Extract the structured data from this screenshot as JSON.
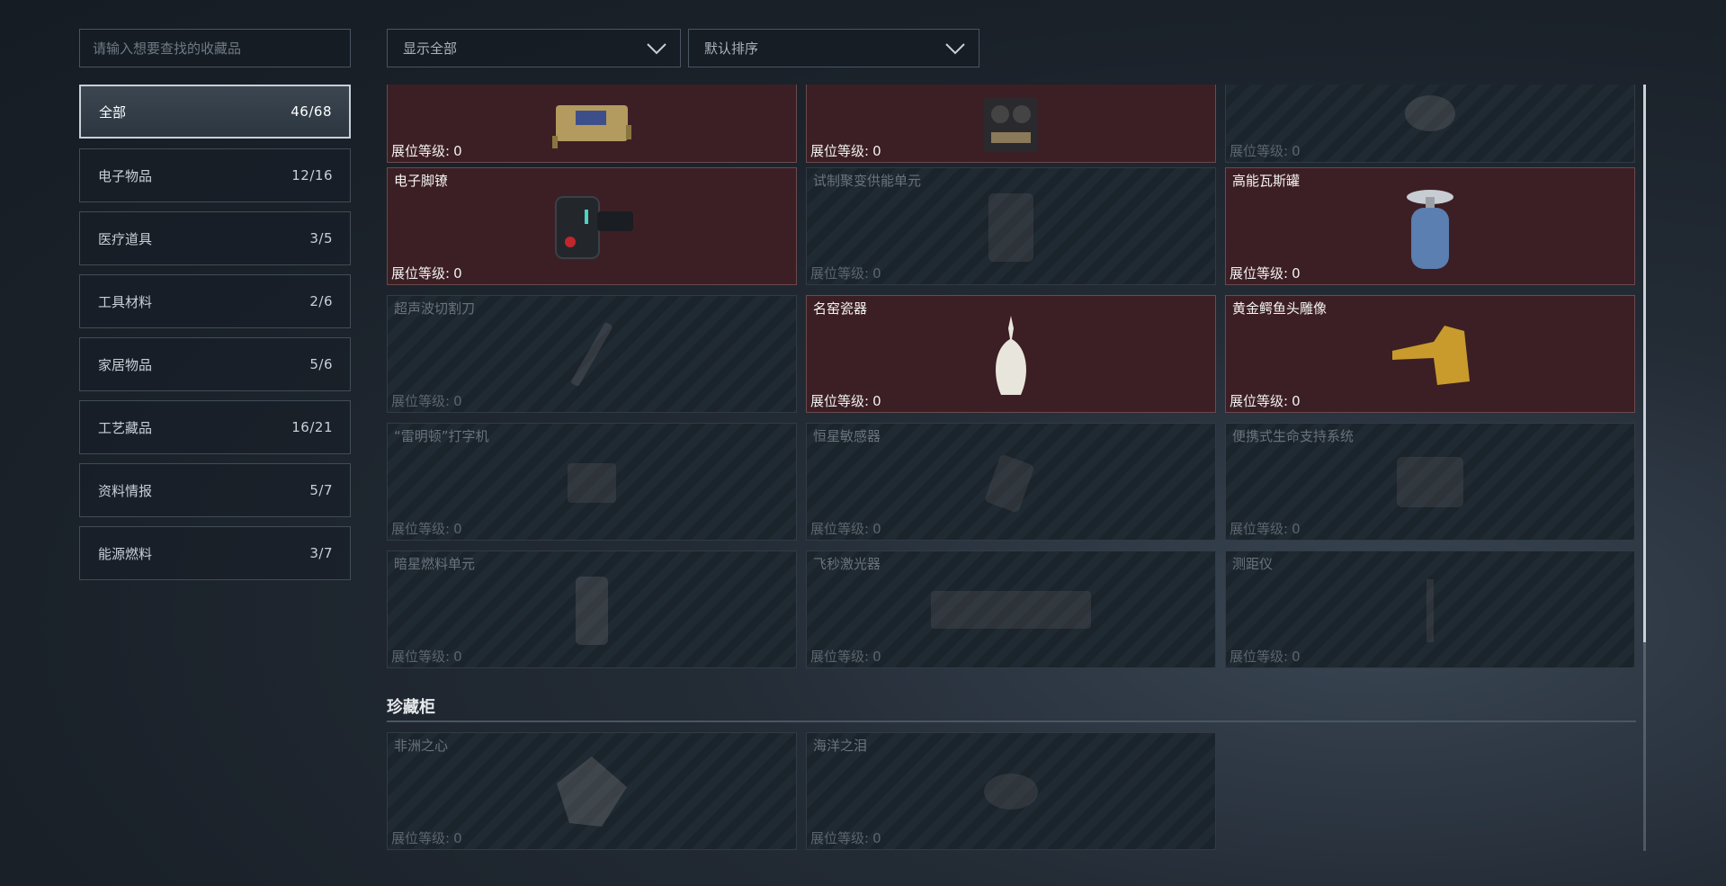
{
  "search": {
    "placeholder": "请输入想要查找的收藏品"
  },
  "filters": {
    "display": "显示全部",
    "sort": "默认排序"
  },
  "sidebar": {
    "items": [
      {
        "label": "全部",
        "count": "46/68"
      },
      {
        "label": "电子物品",
        "count": "12/16"
      },
      {
        "label": "医疗道具",
        "count": "3/5"
      },
      {
        "label": "工具材料",
        "count": "2/6"
      },
      {
        "label": "家居物品",
        "count": "5/6"
      },
      {
        "label": "工艺藏品",
        "count": "16/21"
      },
      {
        "label": "资料情报",
        "count": "5/7"
      },
      {
        "label": "能源燃料",
        "count": "3/7"
      }
    ]
  },
  "level_label": "展位等级:",
  "grid": {
    "items": [
      {
        "name": "",
        "level": "0",
        "owned": true,
        "icon": "router-device-icon"
      },
      {
        "name": "",
        "level": "0",
        "owned": true,
        "icon": "tape-recorder-icon"
      },
      {
        "name": "",
        "level": "0",
        "owned": false,
        "icon": "artifact-icon"
      },
      {
        "name": "电子脚镣",
        "level": "0",
        "owned": true,
        "icon": "ankle-monitor-icon"
      },
      {
        "name": "试制聚变供能单元",
        "level": "0",
        "owned": false,
        "icon": "fusion-unit-icon"
      },
      {
        "name": "高能瓦斯罐",
        "level": "0",
        "owned": true,
        "icon": "gas-canister-icon"
      },
      {
        "name": "超声波切割刀",
        "level": "0",
        "owned": false,
        "icon": "cutter-icon"
      },
      {
        "name": "名窑瓷器",
        "level": "0",
        "owned": true,
        "icon": "porcelain-vase-icon"
      },
      {
        "name": "黄金鳄鱼头雕像",
        "level": "0",
        "owned": true,
        "icon": "gold-crocodile-icon"
      },
      {
        "name": "“雷明顿”打字机",
        "level": "0",
        "owned": false,
        "icon": "typewriter-icon"
      },
      {
        "name": "恒星敏感器",
        "level": "0",
        "owned": false,
        "icon": "star-sensor-icon"
      },
      {
        "name": "便携式生命支持系统",
        "level": "0",
        "owned": false,
        "icon": "life-support-icon"
      },
      {
        "name": "暗星燃料单元",
        "level": "0",
        "owned": false,
        "icon": "fuel-cell-icon"
      },
      {
        "name": "飞秒激光器",
        "level": "0",
        "owned": false,
        "icon": "laser-icon"
      },
      {
        "name": "测距仪",
        "level": "0",
        "owned": false,
        "icon": "rangefinder-icon"
      }
    ]
  },
  "cabinet": {
    "title": "珍藏柜",
    "items": [
      {
        "name": "非洲之心",
        "level": "0",
        "owned": false,
        "icon": "diamond-icon"
      },
      {
        "name": "海洋之泪",
        "level": "0",
        "owned": false,
        "icon": "gem-icon"
      }
    ]
  },
  "colors": {
    "owned_card": "#3c1f24",
    "locked_card": "#1b232b",
    "accent_border": "#c9cfd6"
  }
}
